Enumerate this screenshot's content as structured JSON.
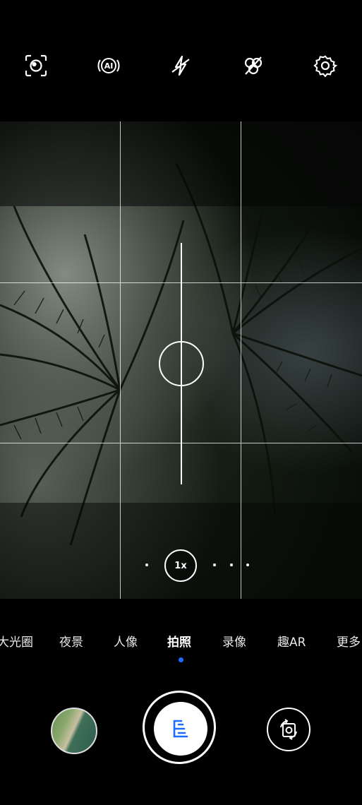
{
  "top_icons": [
    {
      "name": "portrait-focus-icon"
    },
    {
      "name": "ai-camera-icon"
    },
    {
      "name": "flash-off-icon"
    },
    {
      "name": "live-photo-off-icon"
    },
    {
      "name": "settings-gear-icon"
    }
  ],
  "zoom": {
    "label": "1x"
  },
  "modes": [
    {
      "label": "大光圈",
      "active": false
    },
    {
      "label": "夜景",
      "active": false
    },
    {
      "label": "人像",
      "active": false
    },
    {
      "label": "拍照",
      "active": true
    },
    {
      "label": "录像",
      "active": false
    },
    {
      "label": "趣AR",
      "active": false
    },
    {
      "label": "更多",
      "active": false
    }
  ],
  "colors": {
    "accent": "#1f6bff",
    "background": "#000000"
  }
}
